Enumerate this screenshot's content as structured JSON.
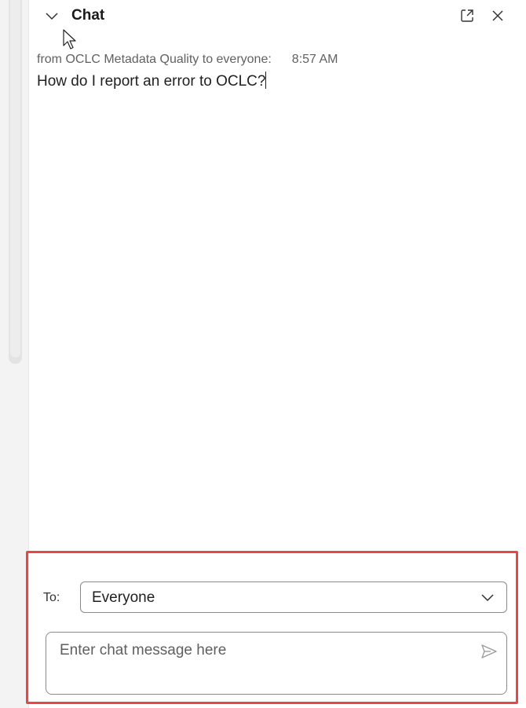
{
  "panel": {
    "title": "Chat",
    "icons": {
      "collapse": "chevron-down-icon",
      "popout": "popout-icon",
      "close": "close-icon"
    }
  },
  "messages": [
    {
      "sender_line": "from OCLC Metadata Quality to everyone:",
      "time": "8:57 AM",
      "text": "How do I report an error to OCLC?"
    }
  ],
  "compose": {
    "to_label": "To:",
    "recipient": "Everyone",
    "placeholder": "Enter chat message here",
    "send_icon": "send-icon",
    "highlight_color": "#e5474f"
  }
}
